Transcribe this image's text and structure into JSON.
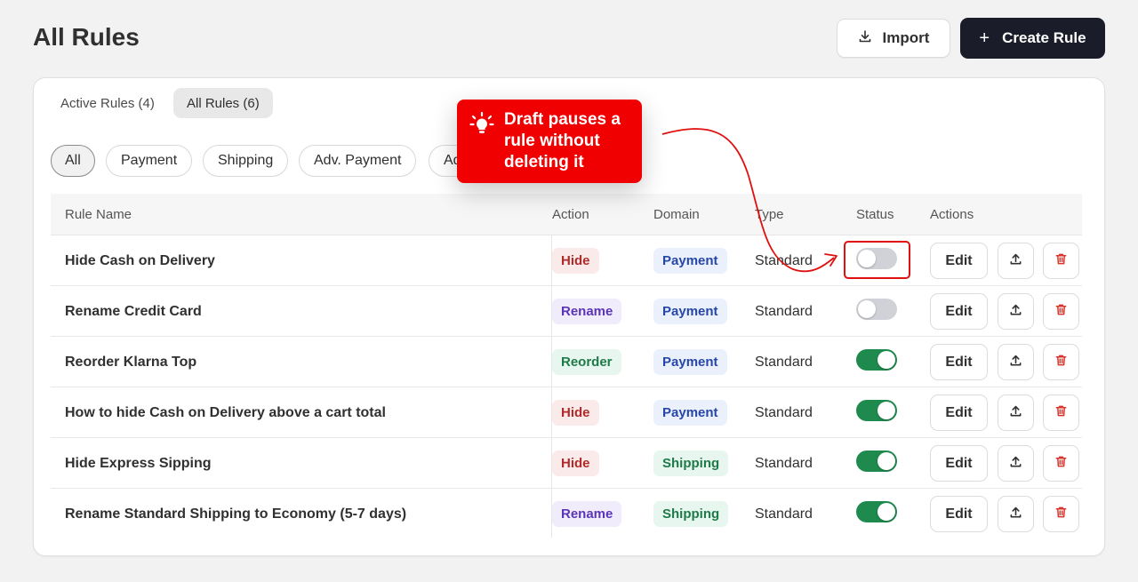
{
  "page": {
    "title": "All Rules"
  },
  "header": {
    "import_label": "Import",
    "create_label": "Create Rule",
    "create_plus": "+"
  },
  "tabs": [
    {
      "label": "Active Rules (4)",
      "active": false
    },
    {
      "label": "All Rules (6)",
      "active": true
    }
  ],
  "filters": [
    {
      "label": "All",
      "selected": true
    },
    {
      "label": "Payment",
      "selected": false
    },
    {
      "label": "Shipping",
      "selected": false
    },
    {
      "label": "Adv. Payment",
      "selected": false
    },
    {
      "label": "Ad",
      "selected": false
    }
  ],
  "table": {
    "columns": {
      "name": "Rule Name",
      "action": "Action",
      "domain": "Domain",
      "type": "Type",
      "status": "Status",
      "actions": "Actions"
    },
    "edit_label": "Edit",
    "rows": [
      {
        "name": "Hide Cash on Delivery",
        "action": "Hide",
        "action_kind": "hide",
        "domain": "Payment",
        "domain_kind": "payment",
        "type": "Standard",
        "enabled": false
      },
      {
        "name": "Rename Credit Card",
        "action": "Rename",
        "action_kind": "rename",
        "domain": "Payment",
        "domain_kind": "payment",
        "type": "Standard",
        "enabled": false
      },
      {
        "name": "Reorder Klarna Top",
        "action": "Reorder",
        "action_kind": "reorder",
        "domain": "Payment",
        "domain_kind": "payment",
        "type": "Standard",
        "enabled": true
      },
      {
        "name": "How to hide Cash on Delivery above a cart total",
        "action": "Hide",
        "action_kind": "hide",
        "domain": "Payment",
        "domain_kind": "payment",
        "type": "Standard",
        "enabled": true
      },
      {
        "name": "Hide Express Sipping",
        "action": "Hide",
        "action_kind": "hide",
        "domain": "Shipping",
        "domain_kind": "shipping",
        "type": "Standard",
        "enabled": true
      },
      {
        "name": "Rename Standard Shipping to Economy (5-7 days)",
        "action": "Rename",
        "action_kind": "rename",
        "domain": "Shipping",
        "domain_kind": "shipping",
        "type": "Standard",
        "enabled": true
      }
    ]
  },
  "callout": {
    "text": "Draft pauses a rule without deleting it"
  },
  "icons": {
    "import": "download-icon",
    "export": "upload-icon",
    "delete": "trash-icon",
    "callout": "lightbulb-icon"
  },
  "colors": {
    "primary": "#1a1d29",
    "toggle_on": "#1e8a4d",
    "toggle_off": "#d0d2d8",
    "callout": "#f00000",
    "delete": "#d9342b"
  }
}
